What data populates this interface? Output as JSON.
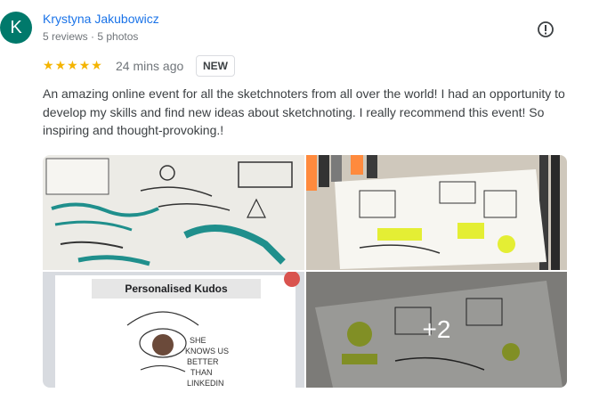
{
  "reviewer": {
    "initial": "K",
    "avatar_color": "#00796b",
    "name": "Krystyna Jakubowicz",
    "meta": "5 reviews · 5 photos"
  },
  "review": {
    "rating": 5,
    "time": "24 mins ago",
    "badge": "NEW",
    "text": "An amazing online event for all the sketchnoters from all over the world! I had an opportunity to develop my skills and find new ideas about sketchnoting. I really recommend this event! So inspiring and thought-provoking.!"
  },
  "photos": {
    "kudos_title": "Personalised Kudos",
    "more_count": "+2"
  },
  "colors": {
    "name": "#1a73e8",
    "star": "#f4b400"
  },
  "icons": {
    "more_options": "report-icon"
  }
}
